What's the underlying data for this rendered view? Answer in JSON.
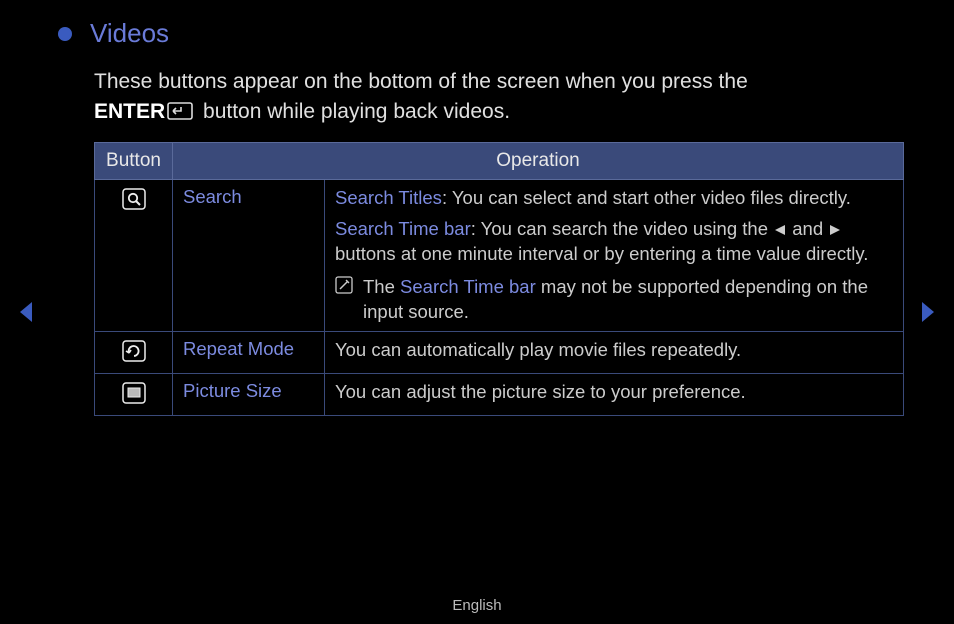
{
  "title": "Videos",
  "intro": {
    "line1": "These buttons appear on the bottom of the screen when you press the",
    "enter_label": "ENTER",
    "line2_suffix": " button while playing back videos."
  },
  "table": {
    "headers": {
      "button": "Button",
      "operation": "Operation"
    },
    "rows": [
      {
        "icon": "search",
        "name": "Search",
        "op": {
          "parts": [
            {
              "hl": "Search Titles",
              "text": ": You can select and start other video files directly."
            },
            {
              "hl": "Search Time bar",
              "text": ": You can search the video using the ",
              "arrows": true,
              "text2": " buttons at one minute interval or by entering a time value directly."
            }
          ],
          "note": {
            "pre": "The ",
            "hl": "Search Time bar",
            "post": " may not be supported depending on the input source."
          }
        }
      },
      {
        "icon": "repeat",
        "name": "Repeat Mode",
        "op": {
          "plain": "You can automatically play movie files repeatedly."
        }
      },
      {
        "icon": "picsize",
        "name": "Picture Size",
        "op": {
          "plain": "You can adjust the picture size to your preference."
        }
      }
    ]
  },
  "footer": {
    "language": "English"
  }
}
